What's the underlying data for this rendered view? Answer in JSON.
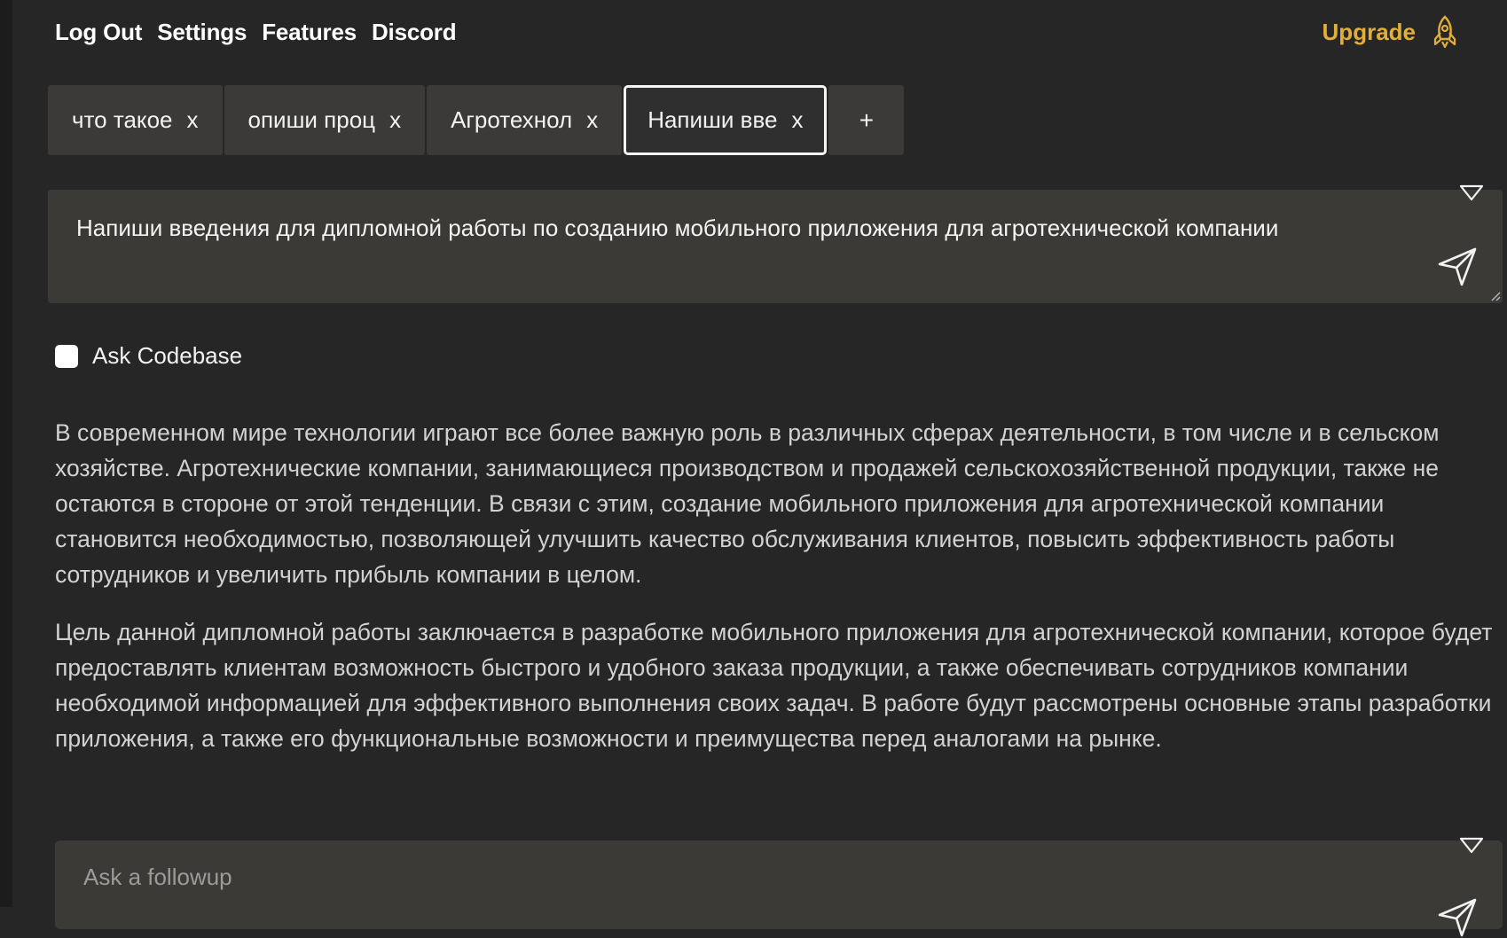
{
  "nav": {
    "items": [
      "Log Out",
      "Settings",
      "Features",
      "Discord"
    ],
    "upgrade_label": "Upgrade",
    "upgrade_icon": "rocket-icon",
    "accent_color": "#e2ae3a"
  },
  "tabs": {
    "items": [
      {
        "label": "что такое",
        "close": "x"
      },
      {
        "label": "опиши проц",
        "close": "x"
      },
      {
        "label": "Агротехнол",
        "close": "x"
      },
      {
        "label": "Напиши вве",
        "close": "x",
        "active": true
      }
    ],
    "add_label": "+"
  },
  "prompt": {
    "text": "Напиши введения для дипломной работы по созданию мобильного приложения для агротехнической компании",
    "collapse_icon": "triangle-down-icon",
    "send_icon": "send-icon"
  },
  "options": {
    "ask_codebase_label": "Ask Codebase",
    "ask_codebase_checked": false
  },
  "answer": {
    "paragraphs": [
      "В современном мире технологии играют все более важную роль в различных сферах деятельности, в том числе и в сельском хозяйстве. Агротехнические компании, занимающиеся производством и продажей сельскохозяйственной продукции, также не остаются в стороне от этой тенденции. В связи с этим, создание мобильного приложения для агротехнической компании становится необходимостью, позволяющей улучшить качество обслуживания клиентов, повысить эффективность работы сотрудников и увеличить прибыль компании в целом.",
      "Цель данной дипломной работы заключается в разработке мобильного приложения для агротехнической компании, которое будет предоставлять клиентам возможность быстрого и удобного заказа продукции, а также обеспечивать сотрудников компании необходимой информацией для эффективного выполнения своих задач. В работе будут рассмотрены основные этапы разработки приложения, а также его функциональные возможности и преимущества перед аналогами на рынке."
    ]
  },
  "followup": {
    "placeholder": "Ask a followup",
    "value": ""
  }
}
